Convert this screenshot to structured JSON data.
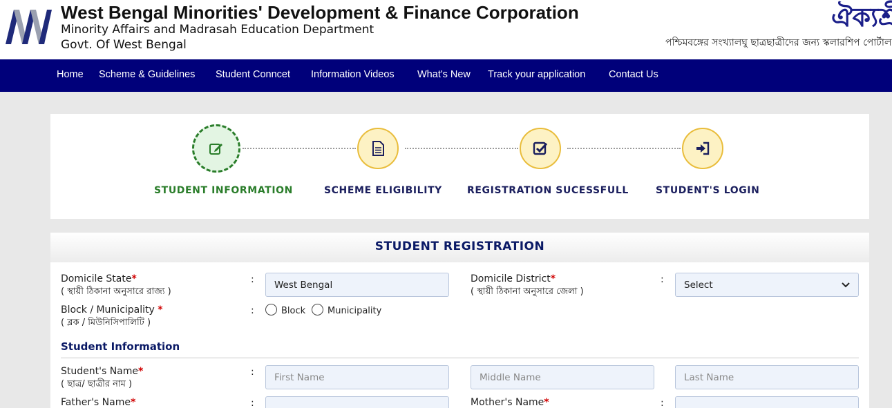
{
  "header": {
    "org_name": "West Bengal Minorities' Development & Finance Corporation",
    "dept_name": "Minority Affairs and Madrasah Education Department",
    "govt_name": "Govt. Of West Bengal",
    "brand_title": "ঐক্যশ্রী",
    "brand_tagline": "পশ্চিমবঙ্গের সংখ্যালঘু ছাত্রছাত্রীদের জন্য স্কলারশিপ পোর্টাল",
    "logo_icon": "wbmdfc-logo-icon"
  },
  "nav": {
    "items": [
      "Home",
      "Scheme & Guidelines",
      "Student Conncet",
      "Information Videos",
      "What's New",
      "Track your application",
      "Contact Us"
    ]
  },
  "stepper": {
    "steps": [
      {
        "label": "STUDENT INFORMATION",
        "icon": "edit-icon",
        "active": true
      },
      {
        "label": "SCHEME ELIGIBILITY",
        "icon": "document-icon",
        "active": false
      },
      {
        "label": "REGISTRATION SUCESSFULL",
        "icon": "checkbox-icon",
        "active": false
      },
      {
        "label": "STUDENT'S LOGIN",
        "icon": "sign-in-icon",
        "active": false
      }
    ]
  },
  "form": {
    "title": "STUDENT REGISTRATION",
    "required_mark": "*",
    "colon": ":",
    "domicile_state": {
      "label": "Domicile State",
      "sub": "( স্থায়ী ঠিকানা অনুসারে রাজ্য )",
      "value": "West Bengal"
    },
    "domicile_district": {
      "label": "Domicile District",
      "sub": "( স্থায়ী ঠিকানা অনুসারে জেলা )",
      "selected": "Select"
    },
    "block_municipality": {
      "label": "Block / Municipality ",
      "sub": "( ব্লক / মিউনিসিপালিটি )",
      "options": [
        "Block",
        "Municipality"
      ]
    },
    "section_student_info": "Student Information",
    "student_name": {
      "label": "Student's Name",
      "sub": "( ছাত্র/ ছাত্রীর নাম )",
      "first_placeholder": "First Name",
      "middle_placeholder": "Middle Name",
      "last_placeholder": "Last Name"
    },
    "father_name": {
      "label": "Father's Name"
    },
    "mother_name": {
      "label": "Mother's Name"
    }
  },
  "colors": {
    "nav_bg": "#00007a",
    "active_step": "#2a7d2a",
    "step_circle_bg": "#fdf2c4",
    "step_circle_border": "#e9bd3c",
    "heading": "#0b1a66",
    "required": "#d00000"
  }
}
